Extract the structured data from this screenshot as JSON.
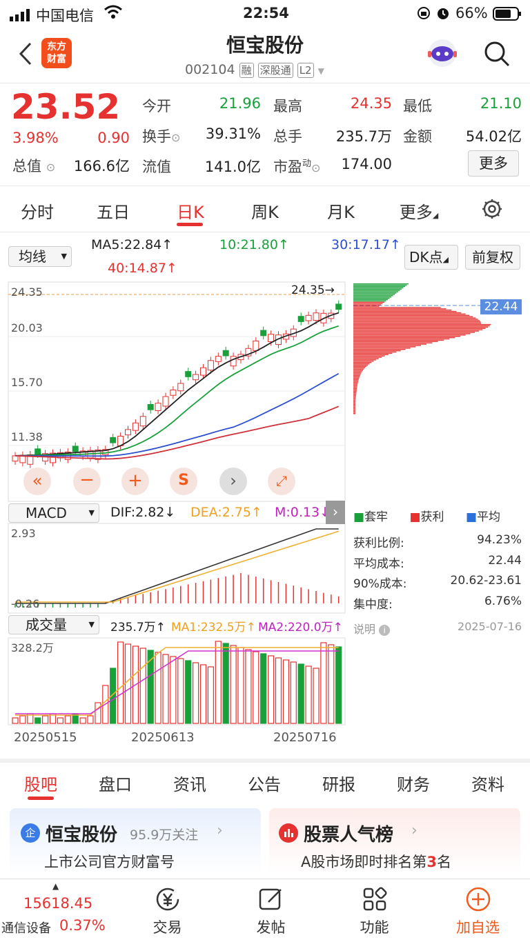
{
  "status_bar": {
    "carrier": "中国电信",
    "time": "22:54",
    "battery": "66%"
  },
  "header": {
    "title": "恒宝股份",
    "code": "002104",
    "tags": [
      "融",
      "深股通",
      "L2"
    ],
    "logo_text_1": "东方",
    "logo_text_2": "财富"
  },
  "quote": {
    "price": "23.52",
    "change_pct": "3.98%",
    "change": "0.90",
    "open_label": "今开",
    "open": "21.96",
    "high_label": "最高",
    "high": "24.35",
    "low_label": "最低",
    "low": "21.10",
    "turnover_label": "换手",
    "turnover": "39.31%",
    "volume_label": "总手",
    "volume": "235.7万",
    "amount_label": "金额",
    "amount": "54.02亿",
    "mcap_label": "总值",
    "mcap": "166.6亿",
    "float_label": "流值",
    "float": "141.0亿",
    "pe_label": "市盈",
    "pe_sup": "动",
    "pe": "174.00",
    "more_label": "更多"
  },
  "tabs": [
    "分时",
    "五日",
    "日K",
    "周K",
    "月K",
    "更多"
  ],
  "ma_bar": {
    "selector": "均线",
    "ma5": "MA5:22.84↑",
    "ma10": "10:21.80↑",
    "ma30": "30:17.17↑",
    "ma40": "40:14.87↑",
    "dk": "DK点",
    "adjust": "前复权"
  },
  "kline": {
    "y_ticks": [
      "24.35",
      "20.03",
      "15.70",
      "11.38"
    ],
    "high_marker": "24.35→",
    "avg_cost_label": "22.44",
    "colors": {
      "up": "#e5312f",
      "down": "#1aa03a",
      "ma5": "#222222",
      "ma10": "#1aa03a",
      "ma30": "#2b4fd0",
      "ma40": "#d0303a"
    }
  },
  "macd": {
    "selector": "MACD",
    "dif": "DIF:2.82↓",
    "dea": "DEA:2.75↑",
    "m": "M:0.13↓",
    "top": "2.93",
    "bottom": "-0.26"
  },
  "volume": {
    "selector": "成交量",
    "v": "235.7万↑",
    "ma1": "MA1:232.5万↑",
    "ma2": "MA2:220.0万↑",
    "top": "328.2万"
  },
  "x_dates": [
    "20250515",
    "20250613",
    "20250716"
  ],
  "chip_dist": {
    "legend": [
      "套牢",
      "获利",
      "平均"
    ],
    "rows": [
      {
        "label": "获利比例:",
        "value": "94.23%"
      },
      {
        "label": "平均成本:",
        "value": "22.44"
      },
      {
        "label": "90%成本:",
        "value": "20.62-23.61"
      },
      {
        "label": "集中度:",
        "value": "6.76%"
      }
    ],
    "note_label": "说明",
    "date": "2025-07-16"
  },
  "sub_tabs": [
    "股吧",
    "盘口",
    "资讯",
    "公告",
    "研报",
    "财务",
    "资料"
  ],
  "cards": [
    {
      "title": "恒宝股份",
      "extra": "95.9万关注",
      "subtitle": "上市公司官方财富号",
      "icon": "企"
    },
    {
      "title": "股票人气榜",
      "subtitle_pre": "A股市场即时排名第",
      "rank": "3",
      "subtitle_post": "名"
    }
  ],
  "bottom_bar": {
    "index_value": "15618.45",
    "index_name": "通信设备",
    "index_change": "0.37%",
    "items": [
      "交易",
      "发帖",
      "功能",
      "加自选"
    ]
  }
}
